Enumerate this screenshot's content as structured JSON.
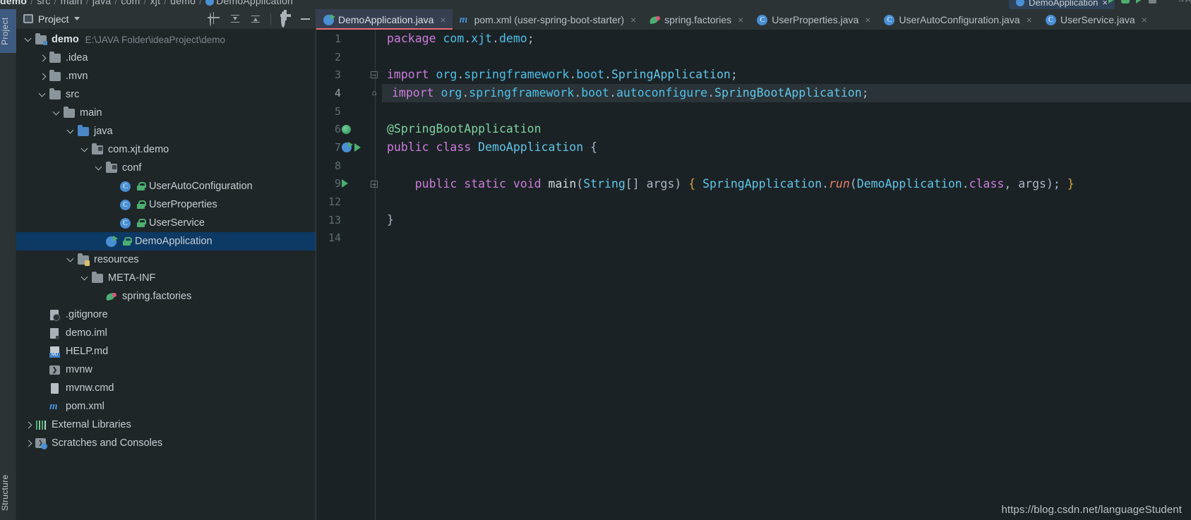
{
  "breadcrumb": {
    "items": [
      "demo",
      "src",
      "main",
      "java",
      "com",
      "xjt",
      "demo",
      "DemoApplication"
    ],
    "separator": "/"
  },
  "top_run_widget": {
    "label": "DemoApplication",
    "close": "×"
  },
  "project_panel": {
    "title": "Project",
    "toolbar": [
      {
        "name": "locate-icon",
        "tooltip": "Select Opened File"
      },
      {
        "name": "expand-all-icon",
        "tooltip": "Expand All"
      },
      {
        "name": "collapse-all-icon",
        "tooltip": "Collapse All"
      },
      {
        "name": "gear-icon",
        "tooltip": "Settings"
      },
      {
        "name": "minimize-icon",
        "tooltip": "Hide"
      }
    ],
    "rail_top": "Project",
    "rail_bottom": "Structure",
    "tree": [
      {
        "indent": 0,
        "twisty": "down",
        "icon": "folder-module",
        "label": "demo",
        "bold": true,
        "path": "E:\\JAVA Folder\\ideaProject\\demo",
        "selected": false
      },
      {
        "indent": 1,
        "twisty": "right",
        "icon": "folder",
        "label": ".idea",
        "bold": false,
        "path": "",
        "selected": false
      },
      {
        "indent": 1,
        "twisty": "right",
        "icon": "folder",
        "label": ".mvn",
        "bold": false,
        "path": "",
        "selected": false
      },
      {
        "indent": 1,
        "twisty": "down",
        "icon": "folder",
        "label": "src",
        "bold": false,
        "path": "",
        "selected": false
      },
      {
        "indent": 2,
        "twisty": "down",
        "icon": "folder",
        "label": "main",
        "bold": false,
        "path": "",
        "selected": false
      },
      {
        "indent": 3,
        "twisty": "down",
        "icon": "folder-source",
        "label": "java",
        "bold": false,
        "path": "",
        "selected": false
      },
      {
        "indent": 4,
        "twisty": "down",
        "icon": "package",
        "label": "com.xjt.demo",
        "bold": false,
        "path": "",
        "selected": false
      },
      {
        "indent": 5,
        "twisty": "down",
        "icon": "package",
        "label": "conf",
        "bold": false,
        "path": "",
        "selected": false
      },
      {
        "indent": 6,
        "twisty": "none",
        "icon": "java-class",
        "label": "UserAutoConfiguration",
        "bold": false,
        "path": "",
        "selected": false,
        "lock": true
      },
      {
        "indent": 6,
        "twisty": "none",
        "icon": "java-class",
        "label": "UserProperties",
        "bold": false,
        "path": "",
        "selected": false,
        "lock": true
      },
      {
        "indent": 6,
        "twisty": "none",
        "icon": "java-class",
        "label": "UserService",
        "bold": false,
        "path": "",
        "selected": false,
        "lock": true
      },
      {
        "indent": 5,
        "twisty": "none",
        "icon": "spring-boot-class",
        "label": "DemoApplication",
        "bold": false,
        "path": "",
        "selected": true,
        "lock": true
      },
      {
        "indent": 3,
        "twisty": "down",
        "icon": "folder-resource",
        "label": "resources",
        "bold": false,
        "path": "",
        "selected": false
      },
      {
        "indent": 4,
        "twisty": "down",
        "icon": "folder",
        "label": "META-INF",
        "bold": false,
        "path": "",
        "selected": false
      },
      {
        "indent": 5,
        "twisty": "none",
        "icon": "spring-leaf",
        "label": "spring.factories",
        "bold": false,
        "path": "",
        "selected": false
      },
      {
        "indent": 1,
        "twisty": "none",
        "icon": "file-gitignore",
        "label": ".gitignore",
        "bold": false,
        "path": "",
        "selected": false
      },
      {
        "indent": 1,
        "twisty": "none",
        "icon": "file-iml",
        "label": "demo.iml",
        "bold": false,
        "path": "",
        "selected": false
      },
      {
        "indent": 1,
        "twisty": "none",
        "icon": "file-markdown",
        "label": "HELP.md",
        "bold": false,
        "path": "",
        "selected": false
      },
      {
        "indent": 1,
        "twisty": "none",
        "icon": "file-shell",
        "label": "mvnw",
        "bold": false,
        "path": "",
        "selected": false
      },
      {
        "indent": 1,
        "twisty": "none",
        "icon": "file-cmd",
        "label": "mvnw.cmd",
        "bold": false,
        "path": "",
        "selected": false
      },
      {
        "indent": 1,
        "twisty": "none",
        "icon": "file-maven",
        "label": "pom.xml",
        "bold": false,
        "path": "",
        "selected": false
      },
      {
        "indent": 0,
        "twisty": "right",
        "icon": "libraries",
        "label": "External Libraries",
        "bold": false,
        "path": "",
        "selected": false
      },
      {
        "indent": 0,
        "twisty": "right",
        "icon": "scratches",
        "label": "Scratches and Consoles",
        "bold": false,
        "path": "",
        "selected": false
      }
    ]
  },
  "editor": {
    "tabs": [
      {
        "label": "DemoApplication.java",
        "icon": "spring-boot-class",
        "active": true,
        "close": "×"
      },
      {
        "label": "pom.xml (user-spring-boot-starter)",
        "icon": "maven",
        "active": false,
        "close": "×"
      },
      {
        "label": "spring.factories",
        "icon": "spring-leaf",
        "active": false,
        "close": "×"
      },
      {
        "label": "UserProperties.java",
        "icon": "java-class",
        "active": false,
        "close": "×"
      },
      {
        "label": "UserAutoConfiguration.java",
        "icon": "java-class",
        "active": false,
        "close": "×"
      },
      {
        "label": "UserService.java",
        "icon": "java-class",
        "active": false,
        "close": "×"
      }
    ],
    "lines": [
      {
        "num": "1",
        "marks": [],
        "fold": "",
        "current": false,
        "tokens": [
          {
            "t": "package ",
            "c": "kw"
          },
          {
            "t": "com",
            "c": "pkgc"
          },
          {
            "t": ".",
            "c": "plain"
          },
          {
            "t": "xjt",
            "c": "pkgc"
          },
          {
            "t": ".",
            "c": "plain"
          },
          {
            "t": "demo",
            "c": "pkgc"
          },
          {
            "t": ";",
            "c": "plain"
          }
        ]
      },
      {
        "num": "2",
        "marks": [],
        "fold": "",
        "current": false,
        "tokens": []
      },
      {
        "num": "3",
        "marks": [],
        "fold": "minus",
        "current": false,
        "tokens": [
          {
            "t": "import ",
            "c": "kw"
          },
          {
            "t": "org",
            "c": "pkgc"
          },
          {
            "t": ".",
            "c": "plain"
          },
          {
            "t": "springframework",
            "c": "pkgc"
          },
          {
            "t": ".",
            "c": "plain"
          },
          {
            "t": "boot",
            "c": "pkgc"
          },
          {
            "t": ".",
            "c": "plain"
          },
          {
            "t": "SpringApplication",
            "c": "cls"
          },
          {
            "t": ";",
            "c": "plain"
          }
        ]
      },
      {
        "num": "4",
        "marks": [],
        "fold": "home",
        "current": true,
        "tokens": [
          {
            "t": "import ",
            "c": "kw"
          },
          {
            "t": "org",
            "c": "pkgc"
          },
          {
            "t": ".",
            "c": "plain"
          },
          {
            "t": "springframework",
            "c": "pkgc"
          },
          {
            "t": ".",
            "c": "plain"
          },
          {
            "t": "boot",
            "c": "pkgc"
          },
          {
            "t": ".",
            "c": "plain"
          },
          {
            "t": "autoconfigure",
            "c": "pkgc"
          },
          {
            "t": ".",
            "c": "plain"
          },
          {
            "t": "SpringBootApplication",
            "c": "cls"
          },
          {
            "t": ";",
            "c": "plain"
          }
        ]
      },
      {
        "num": "5",
        "marks": [],
        "fold": "",
        "current": false,
        "tokens": []
      },
      {
        "num": "6",
        "marks": [
          "bean"
        ],
        "fold": "",
        "current": false,
        "tokens": [
          {
            "t": "@SpringBootApplication",
            "c": "ann2"
          }
        ]
      },
      {
        "num": "7",
        "marks": [
          "spring",
          "run"
        ],
        "fold": "",
        "current": false,
        "tokens": [
          {
            "t": "public ",
            "c": "kw"
          },
          {
            "t": "class ",
            "c": "kw"
          },
          {
            "t": "DemoApplication",
            "c": "cls"
          },
          {
            "t": " {",
            "c": "plain"
          }
        ]
      },
      {
        "num": "8",
        "marks": [],
        "fold": "",
        "current": false,
        "tokens": []
      },
      {
        "num": "9",
        "marks": [
          "run"
        ],
        "fold": "box",
        "current": false,
        "tokens": [
          {
            "t": "    ",
            "c": "plain"
          },
          {
            "t": "public ",
            "c": "kw"
          },
          {
            "t": "static ",
            "c": "kw"
          },
          {
            "t": "void ",
            "c": "kw"
          },
          {
            "t": "main",
            "c": "meth"
          },
          {
            "t": "(",
            "c": "plain"
          },
          {
            "t": "String",
            "c": "cls"
          },
          {
            "t": "[] ",
            "c": "plain"
          },
          {
            "t": "args",
            "c": "plain"
          },
          {
            "t": ") ",
            "c": "plain"
          },
          {
            "t": "{ ",
            "c": "brace"
          },
          {
            "t": "SpringApplication",
            "c": "cls"
          },
          {
            "t": ".",
            "c": "plain"
          },
          {
            "t": "run",
            "c": "methi"
          },
          {
            "t": "(",
            "c": "plain"
          },
          {
            "t": "DemoApplication",
            "c": "cls"
          },
          {
            "t": ".",
            "c": "plain"
          },
          {
            "t": "class",
            "c": "kw"
          },
          {
            "t": ", ",
            "c": "plain"
          },
          {
            "t": "args",
            "c": "plain"
          },
          {
            "t": "); ",
            "c": "plain"
          },
          {
            "t": "}",
            "c": "brace"
          }
        ]
      },
      {
        "num": "12",
        "marks": [],
        "fold": "",
        "current": false,
        "tokens": []
      },
      {
        "num": "13",
        "marks": [],
        "fold": "",
        "current": false,
        "tokens": [
          {
            "t": "}",
            "c": "plain"
          }
        ]
      },
      {
        "num": "14",
        "marks": [],
        "fold": "",
        "current": false,
        "tokens": []
      }
    ]
  },
  "watermark": {
    "text": "https://blog.csdn.net/languageStudent"
  },
  "colors": {
    "accent_tab_underline": "#ec6d74",
    "selection_blue": "#0d3a64",
    "editor_bg": "#1b2225",
    "panel_bg": "#1e2628",
    "toolbar_bg": "#2b3335",
    "spring_green": "#4caf70",
    "class_blue": "#4a8fd4"
  }
}
